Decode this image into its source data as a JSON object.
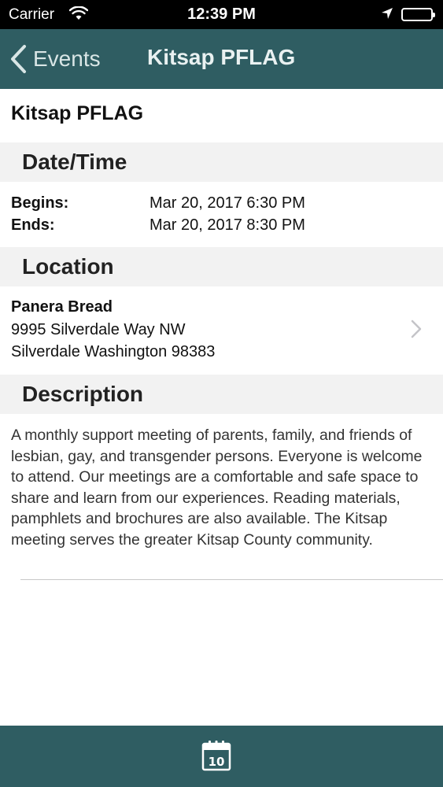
{
  "status_bar": {
    "carrier": "Carrier",
    "time": "12:39 PM"
  },
  "nav": {
    "back_label": "Events",
    "title": "Kitsap PFLAG"
  },
  "event": {
    "title": "Kitsap PFLAG"
  },
  "sections": {
    "datetime": "Date/Time",
    "location": "Location",
    "description": "Description"
  },
  "datetime": {
    "begins_label": "Begins:",
    "begins_value": "Mar 20, 2017 6:30 PM",
    "ends_label": "Ends:",
    "ends_value": "Mar 20, 2017 8:30 PM"
  },
  "location": {
    "name": "Panera Bread",
    "address_line1": "9995 Silverdale Way NW",
    "address_line2": "Silverdale Washington 98383"
  },
  "description": {
    "text": "A monthly support meeting of parents, family, and friends of lesbian, gay, and transgender persons. Everyone is welcome to attend. Our meetings are a comfortable and safe space to share and learn from our experiences. Reading materials, pamphlets and brochures are also available. The Kitsap meeting serves the greater Kitsap County community."
  },
  "tab_bar": {
    "calendar_day": "10"
  },
  "colors": {
    "nav_bg": "#2f5d62",
    "section_bg": "#f2f2f2"
  },
  "icons": {
    "wifi": "wifi-icon",
    "location": "location-arrow-icon",
    "battery": "battery-icon",
    "back": "chevron-left-icon",
    "disclosure": "chevron-right-icon",
    "calendar": "calendar-icon"
  }
}
